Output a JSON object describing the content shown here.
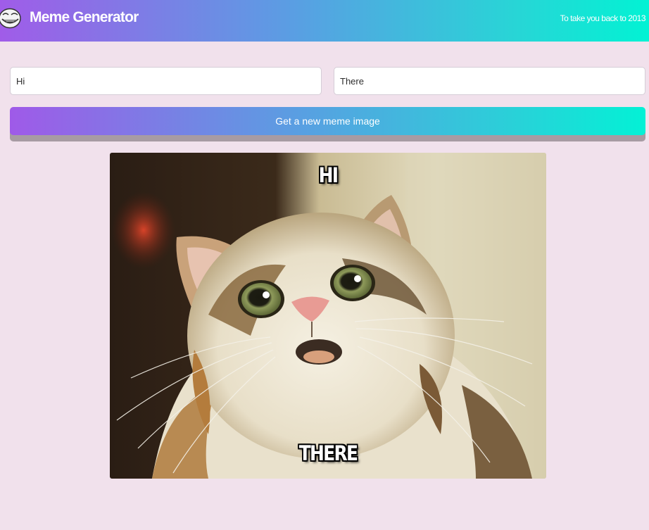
{
  "header": {
    "title": "Meme Generator",
    "tagline": "To take you back to 2013",
    "logo_icon": "trollface-icon"
  },
  "form": {
    "top_text": "Hi",
    "bottom_text": "There",
    "button_label": "Get a new meme image"
  },
  "meme": {
    "image_subject": "surprised-cat-image",
    "top_caption": "HI",
    "bottom_caption": "THERE"
  },
  "colors": {
    "page_background": "#f1e1ec",
    "gradient_start": "#a05ce8",
    "gradient_end": "#02f2d4"
  }
}
